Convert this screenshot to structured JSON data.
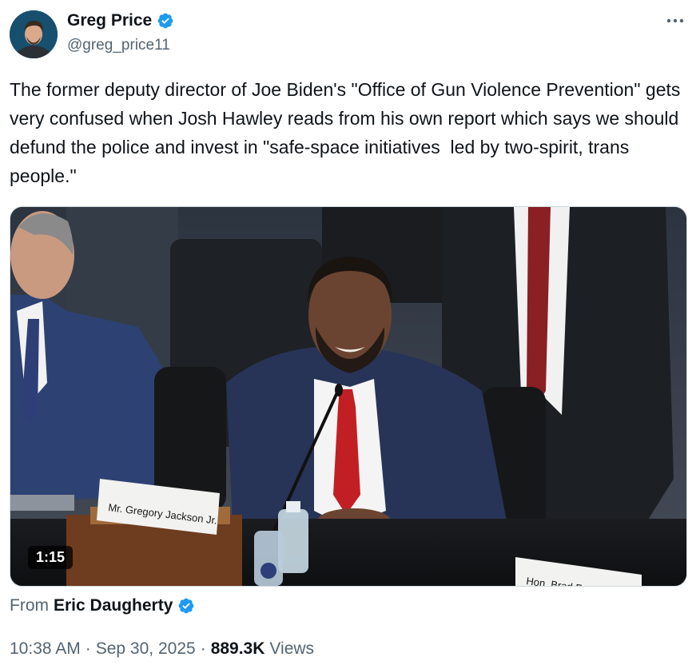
{
  "author": {
    "display_name": "Greg Price",
    "handle": "@greg_price11"
  },
  "tweet": {
    "text": "The former deputy director of Joe Biden's \"Office of Gun Violence Prevention\" gets very confused when Josh Hawley reads from his own report which says we should defund the police and invest in \"safe-space initiatives  led by two-spirit, trans people.\""
  },
  "media": {
    "duration": "1:15",
    "nameplate": "Mr. Gregory Jackson Jr.",
    "nameplate_partial": "Hon. Brad F..."
  },
  "attribution": {
    "label": "From",
    "name": "Eric Daugherty"
  },
  "meta": {
    "time": "10:38 AM",
    "sep1": "·",
    "date": "Sep 30, 2025",
    "sep2": "·",
    "views_count": "889.3K",
    "views_label": "Views"
  },
  "colors": {
    "verified": "#1d9bf0",
    "secondary_text": "#536471",
    "primary_text": "#0f1419"
  },
  "icons": [
    "verified-badge-icon",
    "more-options-icon"
  ]
}
